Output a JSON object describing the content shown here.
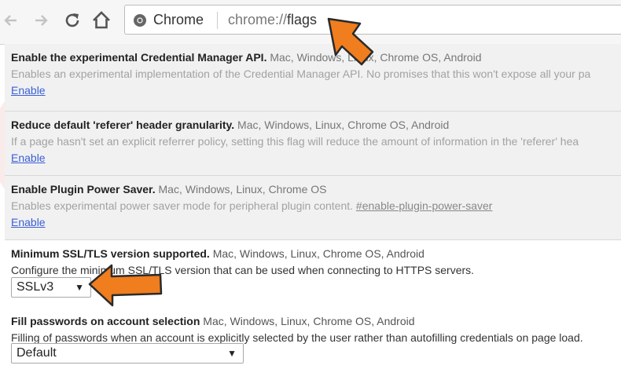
{
  "browser": {
    "omnibox": {
      "site_label": "Chrome",
      "url_prefix": "chrome://",
      "url_path": "flags"
    }
  },
  "flags": [
    {
      "title": "Enable the experimental Credential Manager API.",
      "platforms": "Mac, Windows, Linux, Chrome OS, Android",
      "description": "Enables an experimental implementation of the Credential Manager API. No promises that this won't expose all your pa",
      "link": "Enable"
    },
    {
      "title": "Reduce default 'referer' header granularity.",
      "platforms": "Mac, Windows, Linux, Chrome OS, Android",
      "description": "If a page hasn't set an explicit referrer policy, setting this flag will reduce the amount of information in the 'referer' hea",
      "link": "Enable"
    },
    {
      "title": "Enable Plugin Power Saver.",
      "platforms": "Mac, Windows, Linux, Chrome OS",
      "description": "Enables experimental power saver mode for peripheral plugin content.",
      "anchor": "#enable-plugin-power-saver",
      "link": "Enable"
    },
    {
      "title": "Minimum SSL/TLS version supported.",
      "platforms": "Mac, Windows, Linux, Chrome OS, Android",
      "description": "Configure the minimum SSL/TLS version that can be used when connecting to HTTPS servers.",
      "select_value": "SSLv3"
    },
    {
      "title": "Fill passwords on account selection",
      "platforms": "Mac, Windows, Linux, Chrome OS, Android",
      "description": "Filling of passwords when an account is explicitly selected by the user rather than autofilling credentials on page load.  ",
      "select_value": "Default"
    }
  ],
  "colors": {
    "arrow": "#f07d1e",
    "link": "#3b5fd6",
    "watermark": "#f2c9c9"
  },
  "icons": [
    "back-icon",
    "forward-icon",
    "reload-icon",
    "home-icon",
    "chrome-logo-icon",
    "dropdown-arrow-icon"
  ]
}
